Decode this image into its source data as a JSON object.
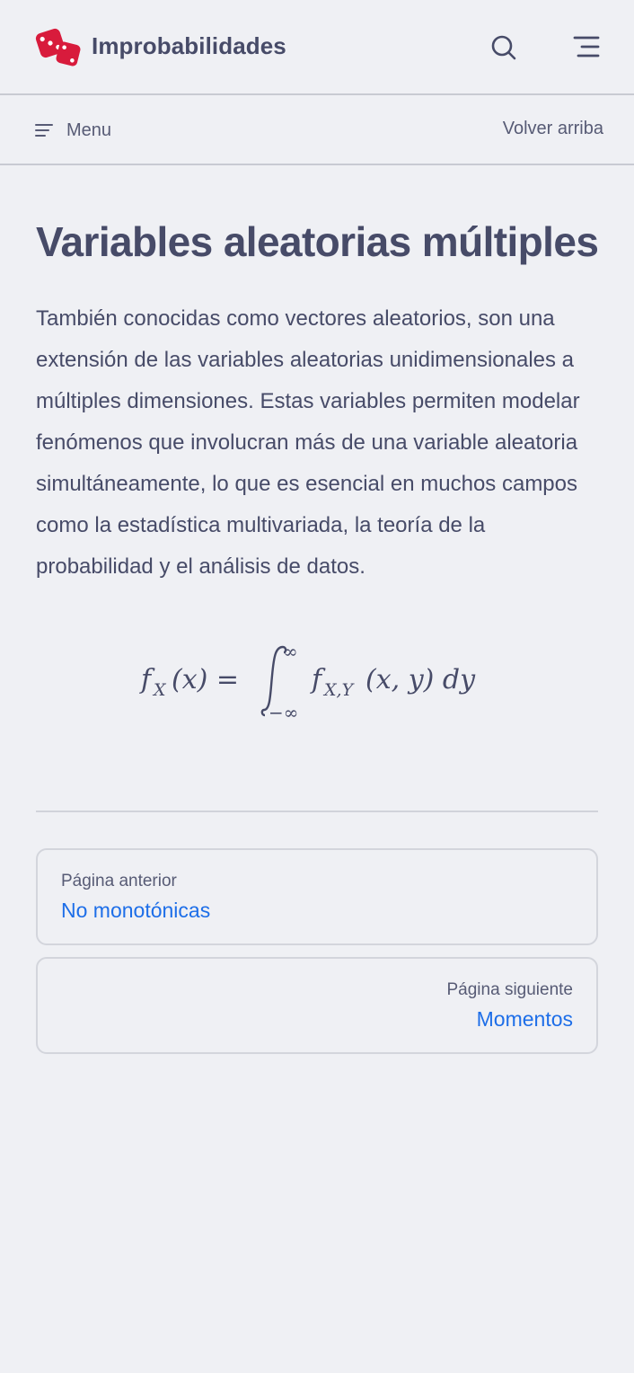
{
  "header": {
    "site_title": "Improbabilidades",
    "logo_icon": "dice-icon",
    "brand_color": "#d81b3c",
    "search_icon": "search-icon",
    "nav_icon": "hamburger-icon"
  },
  "subbar": {
    "menu_label": "Menu",
    "back_to_top": "Volver arriba"
  },
  "article": {
    "title": "Variables aleatorias múltiples",
    "intro": "También conocidas como vectores aleatorios, son una extensión de las variables aleatorias unidimensionales a múltiples dimensiones. Estas variables permiten modelar fenómenos que involucran más de una variable aleatoria simultáneamente, lo que es esencial en muchos campos como la estadística multivariada, la teoría de la probabilidad y el análisis de datos.",
    "formula": {
      "lhs": "f",
      "lhs_sub": "X",
      "lhs_arg": "(x) =",
      "upper": "∞",
      "lower": "−∞",
      "integrand": "f",
      "integrand_sub": "X,Y",
      "integrand_arg": "(x, y) dy"
    }
  },
  "pagination": {
    "prev_caption": "Página anterior",
    "prev_title": "No monotónicas",
    "next_caption": "Página siguiente",
    "next_title": "Momentos",
    "link_color": "#1d6ee8"
  }
}
